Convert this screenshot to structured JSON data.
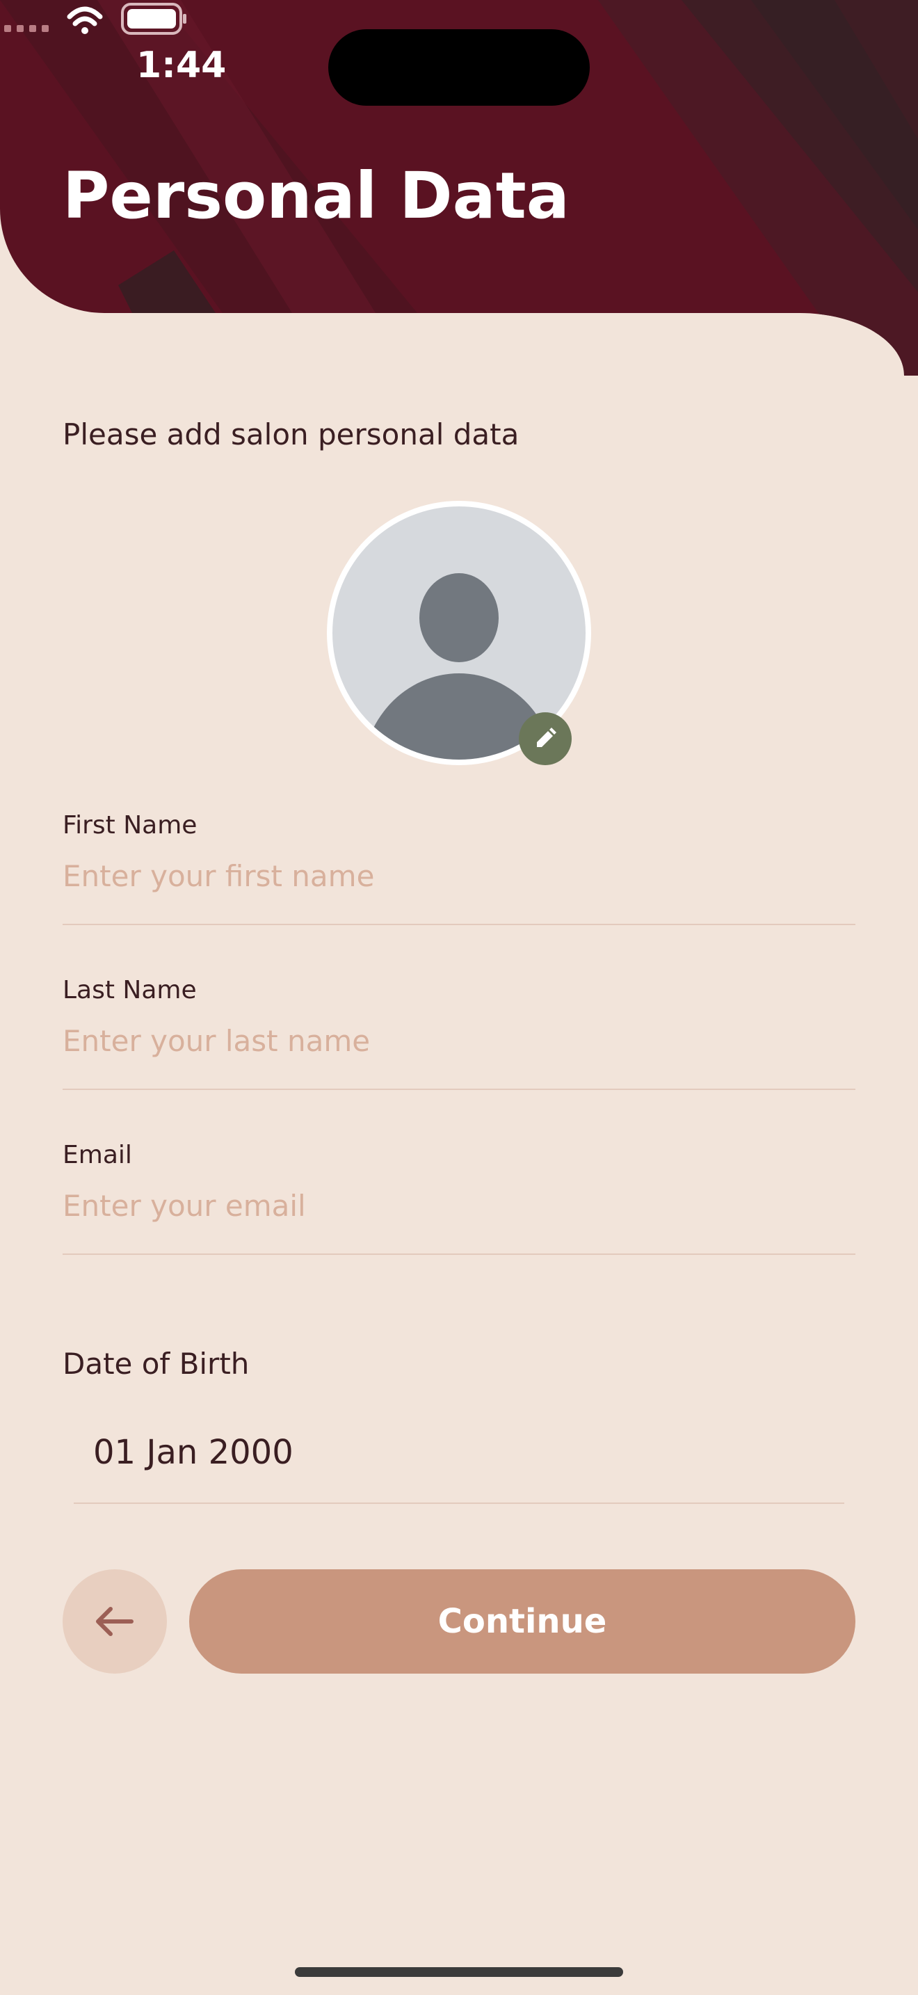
{
  "status_bar": {
    "time": "1:44"
  },
  "header": {
    "title": "Personal Data"
  },
  "subtitle": "Please add salon personal data",
  "form": {
    "first_name": {
      "label": "First Name",
      "placeholder": "Enter your first name",
      "value": ""
    },
    "last_name": {
      "label": "Last Name",
      "placeholder": "Enter your last name",
      "value": ""
    },
    "email": {
      "label": "Email",
      "placeholder": "Enter your email",
      "value": ""
    },
    "dob": {
      "label": "Date of Birth",
      "value": "01 Jan 2000"
    }
  },
  "actions": {
    "continue_label": "Continue"
  },
  "colors": {
    "header_bg": "#5a1222",
    "page_bg": "#f2e4da",
    "primary_button": "#c9967e",
    "back_button": "#e8cfc0",
    "edit_badge": "#6b7759",
    "placeholder_text": "#d8b09c"
  },
  "icons": {
    "back": "arrow-left-icon",
    "edit": "pencil-icon",
    "avatar": "user-placeholder-icon",
    "wifi": "wifi-icon",
    "battery": "battery-icon",
    "signal": "cellular-signal-icon"
  }
}
